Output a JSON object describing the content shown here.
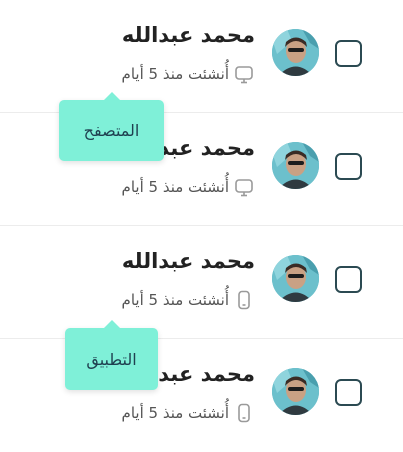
{
  "rows": [
    {
      "name": "محمد عبدالله",
      "meta": "أُنشئت منذ 5 أيام",
      "device_icon": "monitor-icon",
      "selected": false
    },
    {
      "name": "محمد عبدالله",
      "meta": "أُنشئت منذ 5 أيام",
      "device_icon": "monitor-icon",
      "selected": false
    },
    {
      "name": "محمد عبدالله",
      "meta": "أُنشئت منذ 5 أيام",
      "device_icon": "phone-icon",
      "selected": false
    },
    {
      "name": "محمد عبدالله",
      "meta": "أُنشئت منذ 5 أيام",
      "device_icon": "phone-icon",
      "selected": false
    }
  ],
  "tooltips": {
    "browser": "المتصفح",
    "app": "التطبيق"
  },
  "colors": {
    "tooltip_bg": "#7ff0d8",
    "checkbox_border": "#2b4a52",
    "text": "#222222"
  }
}
